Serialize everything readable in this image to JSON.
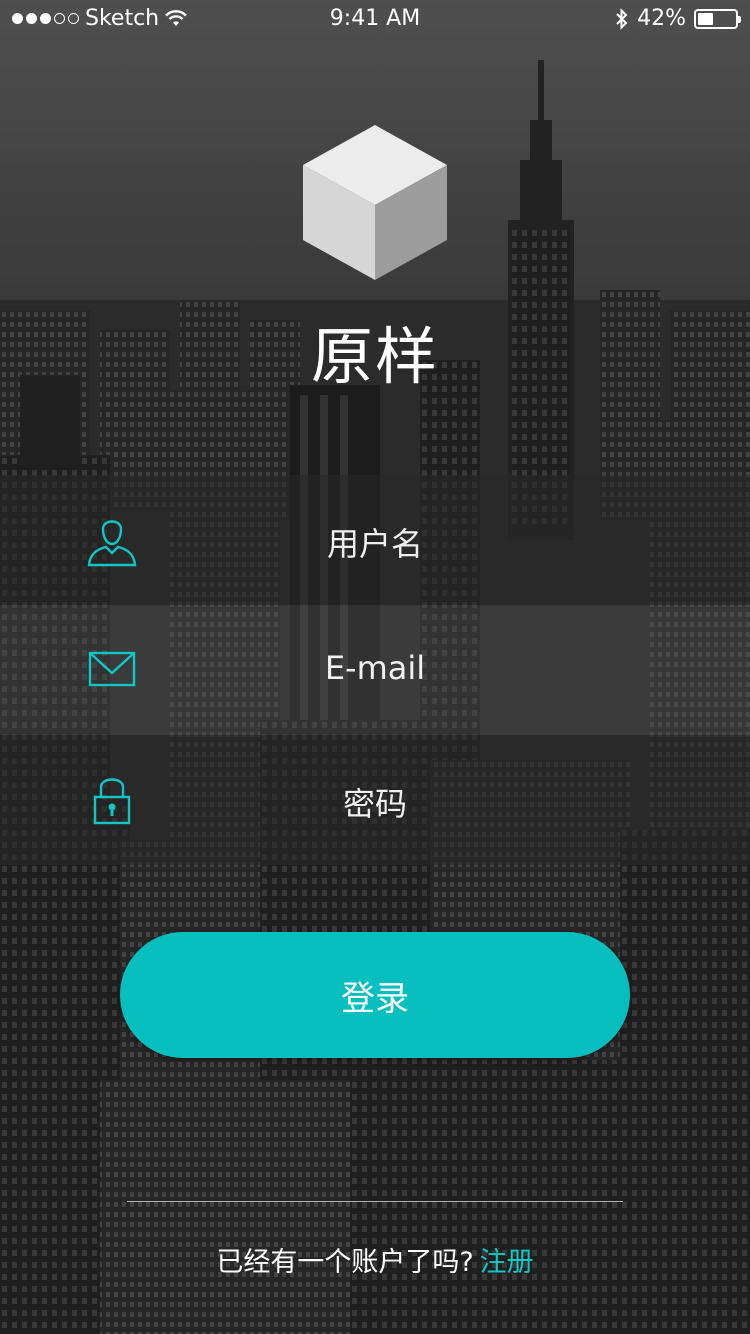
{
  "status_bar": {
    "carrier": "Sketch",
    "time": "9:41 AM",
    "battery_percent": "42%",
    "battery_level": 0.42
  },
  "app": {
    "title": "原样"
  },
  "form": {
    "username_placeholder": "用户名",
    "email_placeholder": "E-mail",
    "password_placeholder": "密码",
    "login_label": "登录"
  },
  "footer": {
    "prompt": "已经有一个账户了吗?",
    "register_link": "注册"
  },
  "colors": {
    "accent": "#08bfbf",
    "link": "#10c8c8"
  },
  "icons": {
    "user": "user-icon",
    "mail": "mail-icon",
    "lock": "lock-icon"
  }
}
